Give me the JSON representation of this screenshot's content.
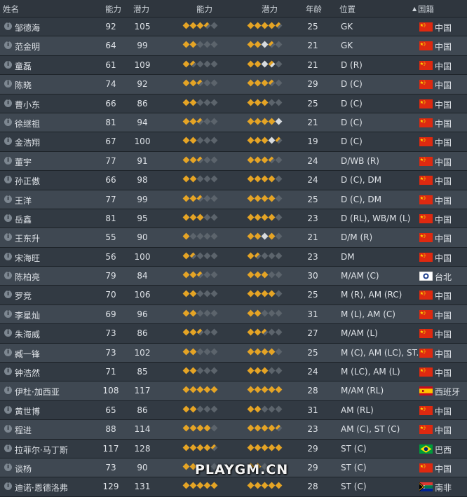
{
  "headers": {
    "name": "姓名",
    "ability": "能力",
    "potential": "潜力",
    "ability_stars": "能力",
    "potential_stars": "潜力",
    "age": "年龄",
    "position": "位置",
    "nationality": "国籍"
  },
  "sort_arrow": "▲",
  "info_glyph": "i",
  "players": [
    {
      "name": "邹德海",
      "ability": "92",
      "potential": "105",
      "ab": [
        "f",
        "f",
        "f",
        "h",
        "e"
      ],
      "po": [
        "f",
        "f",
        "f",
        "f",
        "h"
      ],
      "age": "25",
      "position": "GK",
      "nation": "中国",
      "flag": "cn"
    },
    {
      "name": "范金明",
      "ability": "64",
      "potential": "99",
      "ab": [
        "f",
        "f",
        "e",
        "e",
        "e"
      ],
      "po": [
        "f",
        "f",
        "w",
        "h",
        "e"
      ],
      "age": "21",
      "position": "GK",
      "nation": "中国",
      "flag": "cn"
    },
    {
      "name": "童磊",
      "ability": "61",
      "potential": "109",
      "ab": [
        "f",
        "h",
        "e",
        "e",
        "e"
      ],
      "po": [
        "f",
        "f",
        "w",
        "hw",
        "e"
      ],
      "age": "21",
      "position": "D (R)",
      "nation": "中国",
      "flag": "cn"
    },
    {
      "name": "陈晓",
      "ability": "74",
      "potential": "92",
      "ab": [
        "f",
        "f",
        "h",
        "e",
        "e"
      ],
      "po": [
        "f",
        "f",
        "f",
        "h",
        "e"
      ],
      "age": "29",
      "position": "D (C)",
      "nation": "中国",
      "flag": "cn"
    },
    {
      "name": "曹小东",
      "ability": "66",
      "potential": "86",
      "ab": [
        "f",
        "f",
        "e",
        "e",
        "e"
      ],
      "po": [
        "f",
        "f",
        "f",
        "e",
        "e"
      ],
      "age": "25",
      "position": "D (C)",
      "nation": "中国",
      "flag": "cn"
    },
    {
      "name": "徐继祖",
      "ability": "81",
      "potential": "94",
      "ab": [
        "f",
        "f",
        "h",
        "e",
        "e"
      ],
      "po": [
        "f",
        "f",
        "f",
        "f",
        "w"
      ],
      "age": "21",
      "position": "D (C)",
      "nation": "中国",
      "flag": "cn"
    },
    {
      "name": "金浩翔",
      "ability": "67",
      "potential": "100",
      "ab": [
        "f",
        "f",
        "e",
        "e",
        "e"
      ],
      "po": [
        "f",
        "f",
        "f",
        "w",
        "h"
      ],
      "age": "19",
      "position": "D (C)",
      "nation": "中国",
      "flag": "cn"
    },
    {
      "name": "董宇",
      "ability": "77",
      "potential": "91",
      "ab": [
        "f",
        "f",
        "h",
        "e",
        "e"
      ],
      "po": [
        "f",
        "f",
        "f",
        "h",
        "e"
      ],
      "age": "24",
      "position": "D/WB (R)",
      "nation": "中国",
      "flag": "cn"
    },
    {
      "name": "孙正傲",
      "ability": "66",
      "potential": "98",
      "ab": [
        "f",
        "f",
        "e",
        "e",
        "e"
      ],
      "po": [
        "f",
        "f",
        "f",
        "f",
        "e"
      ],
      "age": "24",
      "position": "D (C), DM",
      "nation": "中国",
      "flag": "cn"
    },
    {
      "name": "王洋",
      "ability": "77",
      "potential": "99",
      "ab": [
        "f",
        "f",
        "h",
        "e",
        "e"
      ],
      "po": [
        "f",
        "f",
        "f",
        "f",
        "e"
      ],
      "age": "25",
      "position": "D (C), DM",
      "nation": "中国",
      "flag": "cn"
    },
    {
      "name": "岳鑫",
      "ability": "81",
      "potential": "95",
      "ab": [
        "f",
        "f",
        "f",
        "e",
        "e"
      ],
      "po": [
        "f",
        "f",
        "f",
        "f",
        "e"
      ],
      "age": "23",
      "position": "D (RL), WB/M (L)",
      "nation": "中国",
      "flag": "cn"
    },
    {
      "name": "王东升",
      "ability": "55",
      "potential": "90",
      "ab": [
        "f",
        "e",
        "e",
        "e",
        "e"
      ],
      "po": [
        "f",
        "f",
        "w",
        "f",
        "e"
      ],
      "age": "21",
      "position": "D/M (R)",
      "nation": "中国",
      "flag": "cn"
    },
    {
      "name": "宋海旺",
      "ability": "56",
      "potential": "100",
      "ab": [
        "f",
        "h",
        "e",
        "e",
        "e"
      ],
      "po": [
        "f",
        "h",
        "e",
        "e",
        "e"
      ],
      "age": "23",
      "position": "DM",
      "nation": "中国",
      "flag": "cn"
    },
    {
      "name": "陈柏亮",
      "ability": "79",
      "potential": "84",
      "ab": [
        "f",
        "f",
        "h",
        "e",
        "e"
      ],
      "po": [
        "f",
        "f",
        "f",
        "e",
        "e"
      ],
      "age": "30",
      "position": "M/AM (C)",
      "nation": "台北",
      "flag": "tpe"
    },
    {
      "name": "罗竞",
      "ability": "70",
      "potential": "106",
      "ab": [
        "f",
        "f",
        "e",
        "e",
        "e"
      ],
      "po": [
        "f",
        "f",
        "f",
        "f",
        "e"
      ],
      "age": "25",
      "position": "M (R), AM (RC)",
      "nation": "中国",
      "flag": "cn"
    },
    {
      "name": "李星灿",
      "ability": "69",
      "potential": "96",
      "ab": [
        "f",
        "f",
        "e",
        "e",
        "e"
      ],
      "po": [
        "f",
        "f",
        "e",
        "e",
        "e"
      ],
      "age": "31",
      "position": "M (L), AM (C)",
      "nation": "中国",
      "flag": "cn"
    },
    {
      "name": "朱海威",
      "ability": "73",
      "potential": "86",
      "ab": [
        "f",
        "f",
        "h",
        "e",
        "e"
      ],
      "po": [
        "f",
        "f",
        "h",
        "e",
        "e"
      ],
      "age": "27",
      "position": "M/AM (L)",
      "nation": "中国",
      "flag": "cn"
    },
    {
      "name": "臧一锋",
      "ability": "73",
      "potential": "102",
      "ab": [
        "f",
        "f",
        "e",
        "e",
        "e"
      ],
      "po": [
        "f",
        "f",
        "f",
        "f",
        "e"
      ],
      "age": "25",
      "position": "M (C), AM (LC), ST...",
      "nation": "中国",
      "flag": "cn"
    },
    {
      "name": "钟浩然",
      "ability": "71",
      "potential": "85",
      "ab": [
        "f",
        "f",
        "e",
        "e",
        "e"
      ],
      "po": [
        "f",
        "f",
        "f",
        "e",
        "e"
      ],
      "age": "24",
      "position": "M (LC), AM (L)",
      "nation": "中国",
      "flag": "cn"
    },
    {
      "name": "伊杜·加西亚",
      "ability": "108",
      "potential": "117",
      "ab": [
        "f",
        "f",
        "f",
        "f",
        "f"
      ],
      "po": [
        "f",
        "f",
        "f",
        "f",
        "f"
      ],
      "age": "28",
      "position": "M/AM (RL)",
      "nation": "西班牙",
      "flag": "es"
    },
    {
      "name": "黄世博",
      "ability": "65",
      "potential": "86",
      "ab": [
        "f",
        "f",
        "e",
        "e",
        "e"
      ],
      "po": [
        "f",
        "f",
        "e",
        "e",
        "e"
      ],
      "age": "31",
      "position": "AM (RL)",
      "nation": "中国",
      "flag": "cn"
    },
    {
      "name": "程进",
      "ability": "88",
      "potential": "114",
      "ab": [
        "f",
        "f",
        "f",
        "f",
        "e"
      ],
      "po": [
        "f",
        "f",
        "f",
        "f",
        "h"
      ],
      "age": "23",
      "position": "AM (C), ST (C)",
      "nation": "中国",
      "flag": "cn"
    },
    {
      "name": "拉菲尔·马丁斯",
      "ability": "117",
      "potential": "128",
      "ab": [
        "f",
        "f",
        "f",
        "f",
        "h"
      ],
      "po": [
        "f",
        "f",
        "f",
        "f",
        "f"
      ],
      "age": "29",
      "position": "ST (C)",
      "nation": "巴西",
      "flag": "br"
    },
    {
      "name": "谈杨",
      "ability": "73",
      "potential": "90",
      "ab": [
        "f",
        "f",
        "e",
        "e",
        "e"
      ],
      "po": [
        "f",
        "f",
        "e",
        "e",
        "e"
      ],
      "age": "29",
      "position": "ST (C)",
      "nation": "中国",
      "flag": "cn"
    },
    {
      "name": "迪诺·恩德洛弗",
      "ability": "129",
      "potential": "131",
      "ab": [
        "f",
        "f",
        "f",
        "f",
        "f"
      ],
      "po": [
        "f",
        "f",
        "f",
        "f",
        "f"
      ],
      "age": "28",
      "position": "ST (C)",
      "nation": "南非",
      "flag": "za"
    }
  ],
  "watermark": "PLAYGM.CN",
  "colors": {
    "star_full": "#e5a425",
    "star_empty": "#5c646c",
    "star_white": "#d7dbdf"
  }
}
